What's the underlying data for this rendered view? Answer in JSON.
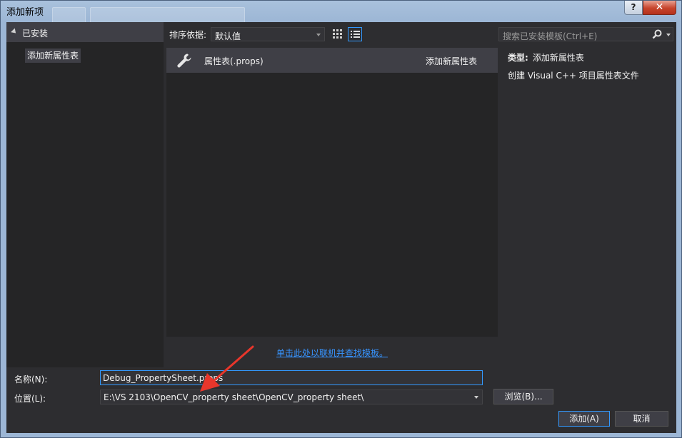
{
  "window": {
    "title": "添加新项",
    "help_label": "?",
    "close_label": "✕"
  },
  "tree": {
    "root_label": "已安装",
    "items": [
      {
        "label": "添加新属性表"
      }
    ]
  },
  "toolbar": {
    "sort_label": "排序依据:",
    "sort_value": "默认值",
    "search_placeholder": "搜索已安装模板(Ctrl+E)"
  },
  "templates": [
    {
      "icon": "wrench-icon",
      "name": "属性表(.props)",
      "category": "添加新属性表"
    }
  ],
  "description": {
    "type_label": "类型:",
    "type_value": "添加新属性表",
    "text": "创建 Visual C++ 项目属性表文件"
  },
  "online_link": "单击此处以联机并查找模板。",
  "form": {
    "name_label": "名称(N):",
    "name_value": "Debug_PropertySheet.props",
    "location_label": "位置(L):",
    "location_value": "E:\\VS 2103\\OpenCV_property sheet\\OpenCV_property sheet\\"
  },
  "buttons": {
    "browse": "浏览(B)...",
    "add": "添加(A)",
    "cancel": "取消"
  },
  "colors": {
    "dialog_bg": "#2d2d30",
    "pane_bg": "#252526",
    "selection": "#3f3f46",
    "accent": "#3399ff",
    "link": "#3794ff",
    "arrow": "#e8362b",
    "close": "#c7442c"
  }
}
